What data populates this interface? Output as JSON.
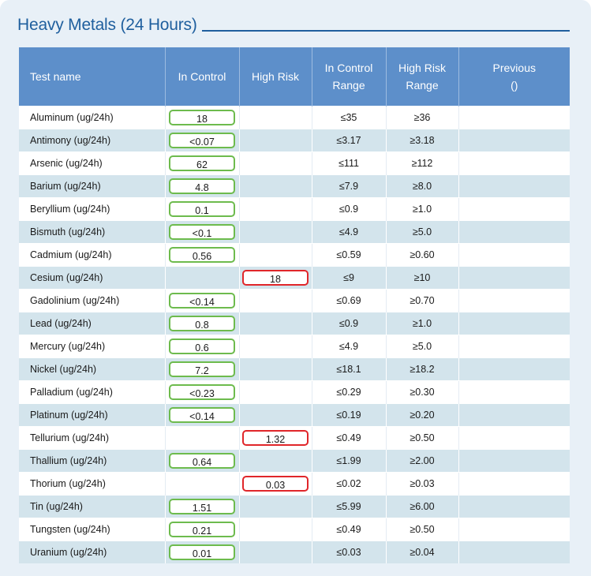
{
  "section": {
    "title": "Heavy Metals (24 Hours)"
  },
  "table": {
    "headers": [
      "Test name",
      "In Control",
      "High Risk",
      "In Control Range",
      "High Risk Range",
      "Previous ()"
    ],
    "rows": [
      {
        "name": "Aluminum (ug/24h)",
        "in_control": "18",
        "high_risk": "",
        "in_range": "≤35",
        "risk_range": "≥36",
        "previous": ""
      },
      {
        "name": "Antimony (ug/24h)",
        "in_control": "<0.07",
        "high_risk": "",
        "in_range": "≤3.17",
        "risk_range": "≥3.18",
        "previous": ""
      },
      {
        "name": "Arsenic (ug/24h)",
        "in_control": "62",
        "high_risk": "",
        "in_range": "≤111",
        "risk_range": "≥112",
        "previous": ""
      },
      {
        "name": "Barium (ug/24h)",
        "in_control": "4.8",
        "high_risk": "",
        "in_range": "≤7.9",
        "risk_range": "≥8.0",
        "previous": ""
      },
      {
        "name": "Beryllium (ug/24h)",
        "in_control": "0.1",
        "high_risk": "",
        "in_range": "≤0.9",
        "risk_range": "≥1.0",
        "previous": ""
      },
      {
        "name": "Bismuth (ug/24h)",
        "in_control": "<0.1",
        "high_risk": "",
        "in_range": "≤4.9",
        "risk_range": "≥5.0",
        "previous": ""
      },
      {
        "name": "Cadmium (ug/24h)",
        "in_control": "0.56",
        "high_risk": "",
        "in_range": "≤0.59",
        "risk_range": "≥0.60",
        "previous": ""
      },
      {
        "name": "Cesium (ug/24h)",
        "in_control": "",
        "high_risk": "18",
        "in_range": "≤9",
        "risk_range": "≥10",
        "previous": ""
      },
      {
        "name": "Gadolinium (ug/24h)",
        "in_control": "<0.14",
        "high_risk": "",
        "in_range": "≤0.69",
        "risk_range": "≥0.70",
        "previous": ""
      },
      {
        "name": "Lead (ug/24h)",
        "in_control": "0.8",
        "high_risk": "",
        "in_range": "≤0.9",
        "risk_range": "≥1.0",
        "previous": ""
      },
      {
        "name": "Mercury (ug/24h)",
        "in_control": "0.6",
        "high_risk": "",
        "in_range": "≤4.9",
        "risk_range": "≥5.0",
        "previous": ""
      },
      {
        "name": "Nickel (ug/24h)",
        "in_control": "7.2",
        "high_risk": "",
        "in_range": "≤18.1",
        "risk_range": "≥18.2",
        "previous": ""
      },
      {
        "name": "Palladium (ug/24h)",
        "in_control": "<0.23",
        "high_risk": "",
        "in_range": "≤0.29",
        "risk_range": "≥0.30",
        "previous": ""
      },
      {
        "name": "Platinum (ug/24h)",
        "in_control": "<0.14",
        "high_risk": "",
        "in_range": "≤0.19",
        "risk_range": "≥0.20",
        "previous": ""
      },
      {
        "name": "Tellurium (ug/24h)",
        "in_control": "",
        "high_risk": "1.32",
        "in_range": "≤0.49",
        "risk_range": "≥0.50",
        "previous": ""
      },
      {
        "name": "Thallium (ug/24h)",
        "in_control": "0.64",
        "high_risk": "",
        "in_range": "≤1.99",
        "risk_range": "≥2.00",
        "previous": ""
      },
      {
        "name": "Thorium (ug/24h)",
        "in_control": "",
        "high_risk": "0.03",
        "in_range": "≤0.02",
        "risk_range": "≥0.03",
        "previous": ""
      },
      {
        "name": "Tin (ug/24h)",
        "in_control": "1.51",
        "high_risk": "",
        "in_range": "≤5.99",
        "risk_range": "≥6.00",
        "previous": ""
      },
      {
        "name": "Tungsten (ug/24h)",
        "in_control": "0.21",
        "high_risk": "",
        "in_range": "≤0.49",
        "risk_range": "≥0.50",
        "previous": ""
      },
      {
        "name": "Uranium (ug/24h)",
        "in_control": "0.01",
        "high_risk": "",
        "in_range": "≤0.03",
        "risk_range": "≥0.04",
        "previous": ""
      }
    ]
  },
  "colors": {
    "header_bg": "#5d8fca",
    "title": "#1f5f9e",
    "in_control_border": "#6dbb4d",
    "high_risk_border": "#e0262a",
    "row_stripe": "#d3e4ec"
  }
}
